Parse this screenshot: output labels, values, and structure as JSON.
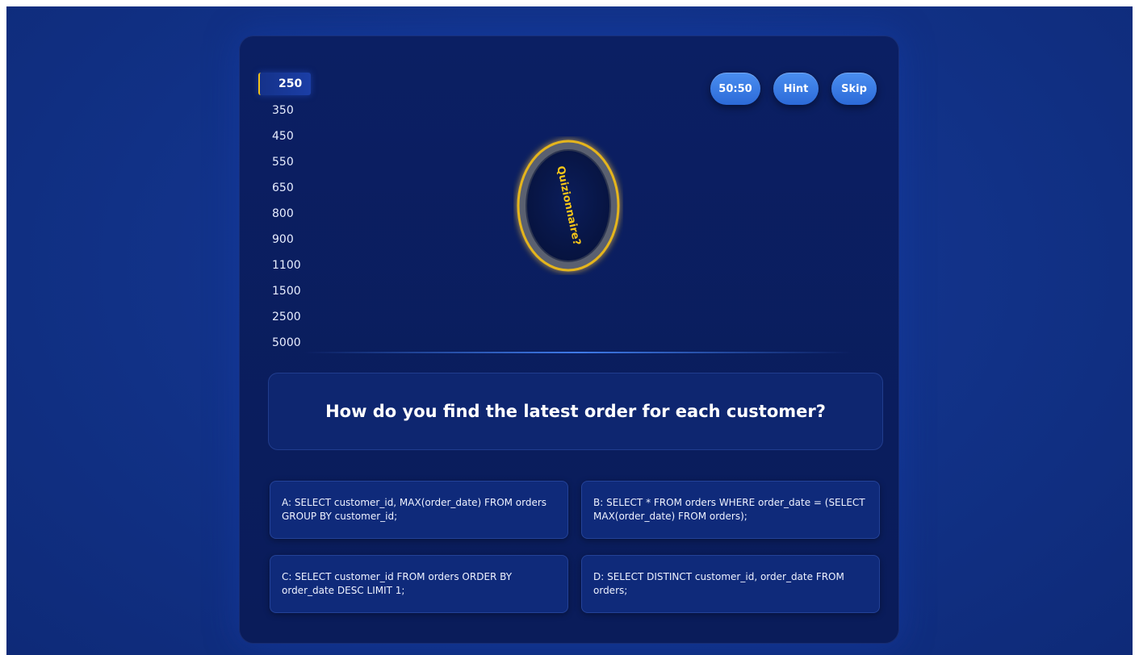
{
  "ladder": [
    "250",
    "350",
    "450",
    "550",
    "650",
    "800",
    "900",
    "1100",
    "1500",
    "2500",
    "5000"
  ],
  "lifelines": {
    "fifty_fifty": "50:50",
    "hint": "Hint",
    "skip": "Skip"
  },
  "logo": {
    "text": "Quizionnaire?"
  },
  "question": {
    "text": "How do you find the latest order for each customer?"
  },
  "answers": [
    "A: SELECT customer_id, MAX(order_date) FROM orders GROUP BY customer_id;",
    "B: SELECT * FROM orders WHERE order_date = (SELECT MAX(order_date) FROM orders);",
    "C: SELECT customer_id FROM orders ORDER BY order_date DESC LIMIT 1;",
    "D: SELECT DISTINCT customer_id, order_date FROM orders;"
  ],
  "colors": {
    "background": "#12338a",
    "panel": "#0a1c5a",
    "accent_gold": "#f2c21a",
    "button_blue": "#3b7ce6"
  }
}
